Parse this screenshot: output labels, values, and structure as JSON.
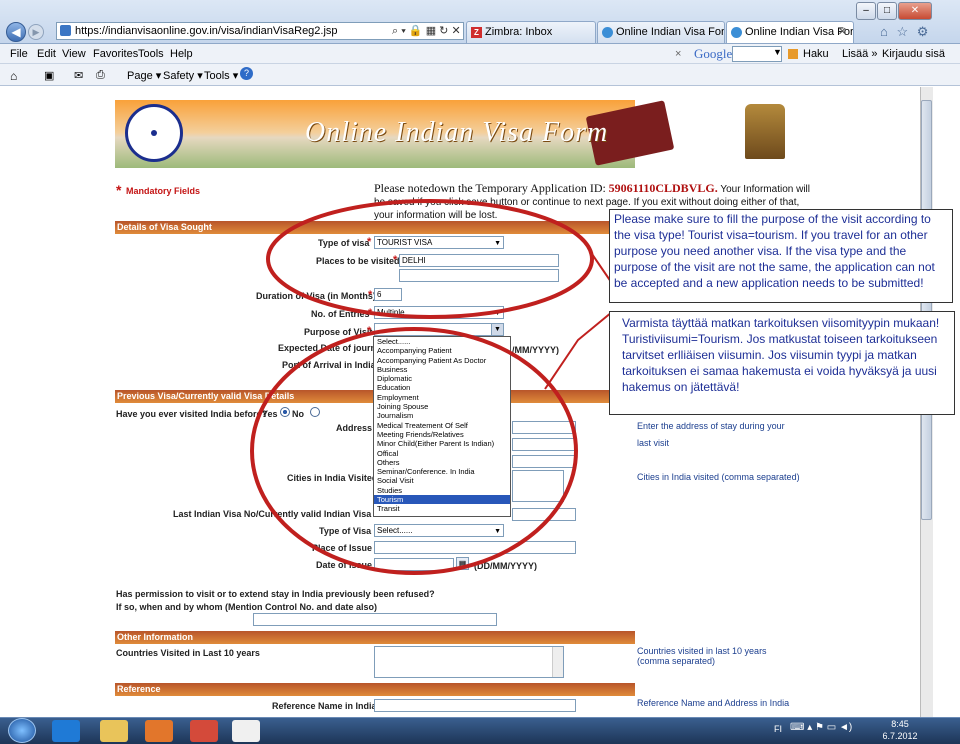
{
  "browser": {
    "url": "https://indianvisaonline.gov.in/visa/indianVisaReg2.jsp",
    "tabs": [
      {
        "label": "Zimbra: Inbox"
      },
      {
        "label": "Online Indian Visa Form"
      },
      {
        "label": "Online Indian Visa Form"
      }
    ],
    "menu": [
      "File",
      "Edit",
      "View",
      "Favorites",
      "Tools",
      "Help"
    ],
    "commands": [
      "Page ▾",
      "Safety ▾",
      "Tools ▾"
    ],
    "search_close": "×",
    "search_engine": "Google",
    "haku": "Haku",
    "lisaa": "Lisää »",
    "kirjaudu": "Kirjaudu sisä"
  },
  "banner": {
    "title": "Online Indian Visa Form"
  },
  "form": {
    "mandatory": "Mandatory Fields",
    "notice_lead": "Please notedown the Temporary Application ID:",
    "app_id": "59061110CLDBVLG.",
    "notice_rest": "Your Information will be saved if you click save button or continue to next page. If you exit without doing either of that, your information will be lost.",
    "sections": {
      "details": "Details of Visa Sought",
      "previous": "Previous Visa/Currently valid Visa Details",
      "other": "Other Information",
      "reference": "Reference"
    },
    "labels": {
      "type_of_visa": "Type of visa",
      "places": "Places to be visited",
      "duration": "Duration of Visa (in Months)",
      "entries": "No. of Entries",
      "purpose": "Purpose of Visit",
      "expected_date": "Expected Date of journey",
      "port": "Port of Arrival in India",
      "visited_before": "Have you ever visited India before?",
      "yes": "Yes",
      "no": "No",
      "address": "Address",
      "cities": "Cities in India Visited",
      "last_visa": "Last Indian Visa No/Currently valid Indian Visa No.",
      "type_of_visa2": "Type of Visa",
      "place_issue": "Place of Issue",
      "date_issue": "Date of Issue",
      "date_format": "(DD/MM/YYYY)",
      "date_format2": "/MM/YYYY)",
      "refused": "Has permission to visit or to extend stay in India previously been refused?",
      "refused_by": "If so, when and by whom (Mention Control No. and date also)",
      "countries": "Countries Visited in Last 10 years",
      "reference_name": "Reference Name in India"
    },
    "values": {
      "type_of_visa": "TOURIST VISA",
      "places": "DELHI",
      "duration": "6",
      "entries": "Multiple",
      "type_of_visa2": "Select......"
    },
    "hints": {
      "address": "Enter the address of stay during your",
      "last_visit": "last visit",
      "cities": "Cities in India visited (comma separated)",
      "countries": "Countries visited in last 10 years",
      "countries2": "(comma separated)",
      "reference": "Reference Name and Address in India"
    },
    "purpose_options": [
      "Select......",
      "Accompanying Patient",
      "Accompanying Patient As Doctor",
      "Business",
      "Diplomatic",
      "Education",
      "Employment",
      "Joining Spouse",
      "Journalism",
      "Medical Treatement Of Self",
      "Meeting Friends/Relatives",
      "Minor Child(Either Parent Is Indian)",
      "Offical",
      "Others",
      "Seminar/Conference. In India",
      "Social Visit",
      "Studies",
      "Tourism",
      "Transit"
    ],
    "purpose_selected": "Tourism"
  },
  "callouts": {
    "english": "Please make sure to fill the purpose of the visit according to the visa type! Tourist visa=tourism. If you travel for an other purpose you need another visa. If the visa type and the purpose of the visit are not the same, the application can not be accepted and a new application needs to be submitted!",
    "finnish": "Varmista täyttää matkan tarkoituksen viisomityypin mukaan! Turistiviisumi=Tourism. Jos matkustat toiseen tarkoitukseen tarvitset erlliäisen viisumin. Jos viisumin tyypi ja matkan tarkoituksen ei samaa hakemusta ei voida hyväksyä ja uusi hakemus on jätettävä!"
  },
  "taskbar": {
    "lang": "FI",
    "time": "8:45",
    "date": "6.7.2012"
  },
  "colors": {
    "annotation_red": "#c0201e",
    "section_orange": "#d9772f",
    "callout_text": "#1e2f96"
  }
}
